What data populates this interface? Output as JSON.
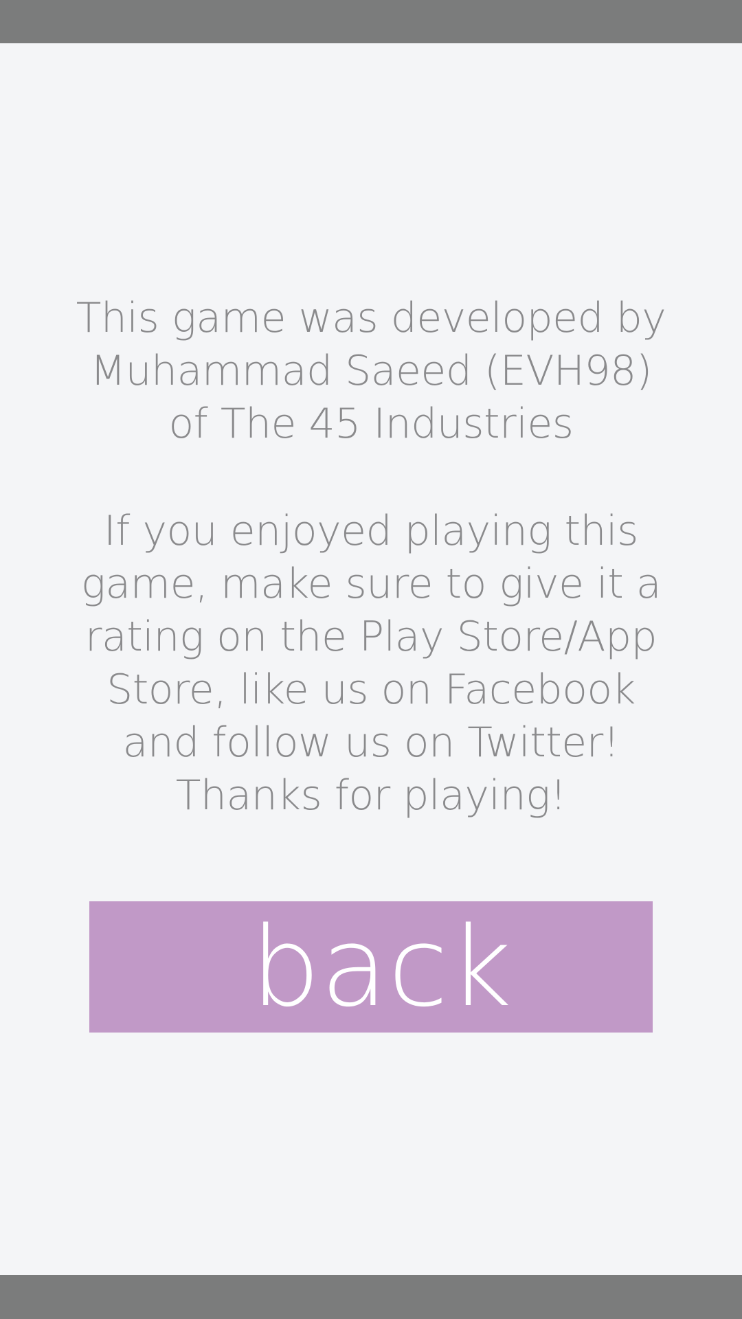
{
  "credits": {
    "lines": [
      "This game was developed by",
      "Muhammad Saeed (EVH98)",
      "of The 45 Industries"
    ]
  },
  "message": {
    "lines": [
      "If you enjoyed playing this",
      "game, make sure to give it a",
      "rating on the Play Store/App",
      "Store, like us on Facebook",
      "and follow us on Twitter!",
      "Thanks for playing!"
    ]
  },
  "back_button": {
    "label": "back",
    "color": "#c199c7"
  },
  "colors": {
    "background": "#f4f5f7",
    "system_bars": "#7b7c7c",
    "text": "#8a8a8c"
  }
}
